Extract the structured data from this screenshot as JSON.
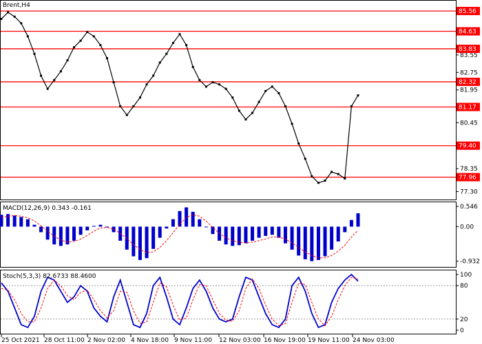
{
  "chart_data": {
    "type": "candlestick",
    "symbol_label": "Brent,H4",
    "price_axis_ticks": [
      "85.56",
      "84.63",
      "83.83",
      "83.55",
      "82.75",
      "82.32",
      "81.95",
      "81.17",
      "80.45",
      "79.40",
      "78.35",
      "77.96",
      "77.30"
    ],
    "time_axis_ticks": [
      "25 Oct 2021",
      "28 Oct 11:00",
      "2 Nov 02:00",
      "4 Nov 18:00",
      "9 Nov 11:00",
      "12 Nov 03:00",
      "16 Nov 19:00",
      "19 Nov 11:00",
      "24 Nov 03:00"
    ],
    "ylim": [
      77.0,
      86.0
    ],
    "horizontal_levels": [
      {
        "label": "85.56",
        "value": 85.56
      },
      {
        "label": "84.63",
        "value": 84.63
      },
      {
        "label": "83.83",
        "value": 83.83
      },
      {
        "label": "82.32",
        "value": 82.32
      },
      {
        "label": "81.17",
        "value": 81.17
      },
      {
        "label": "79.40",
        "value": 79.4
      },
      {
        "label": "77.96",
        "value": 77.96
      }
    ],
    "level_color": "#ff0000",
    "series": [
      {
        "name": "close",
        "color": "#000000",
        "values": [
          85.2,
          85.5,
          85.3,
          85.0,
          84.4,
          83.6,
          82.6,
          82.0,
          82.4,
          82.8,
          83.3,
          83.9,
          84.2,
          84.6,
          84.4,
          84.0,
          83.4,
          82.3,
          81.2,
          80.8,
          81.2,
          81.6,
          82.2,
          82.6,
          83.2,
          83.6,
          84.1,
          84.5,
          84.0,
          83.0,
          82.4,
          82.1,
          82.3,
          82.2,
          82.0,
          81.6,
          81.0,
          80.6,
          80.9,
          81.4,
          81.9,
          82.1,
          81.8,
          81.2,
          80.4,
          79.5,
          78.8,
          78.0,
          77.7,
          77.8,
          78.2,
          78.1,
          77.9,
          81.2,
          81.7
        ]
      }
    ],
    "indicators": [
      {
        "label": "MACD(12,26,9) 0.343 -0.161",
        "axis_ticks": [
          "0.546",
          "0.00",
          "-0.932"
        ],
        "ylim": [
          -1.05,
          0.62
        ],
        "histogram_color": "#0000cc",
        "signal_color": "#ff0000",
        "histogram": [
          0.32,
          0.34,
          0.3,
          0.26,
          0.2,
          0.05,
          -0.15,
          -0.35,
          -0.48,
          -0.52,
          -0.48,
          -0.38,
          -0.22,
          -0.1,
          0.02,
          0.05,
          0.0,
          -0.15,
          -0.38,
          -0.62,
          -0.8,
          -0.9,
          -0.85,
          -0.6,
          -0.3,
          -0.05,
          0.2,
          0.42,
          0.52,
          0.4,
          0.2,
          0.0,
          -0.2,
          -0.38,
          -0.48,
          -0.52,
          -0.5,
          -0.45,
          -0.38,
          -0.3,
          -0.25,
          -0.22,
          -0.3,
          -0.45,
          -0.62,
          -0.78,
          -0.88,
          -0.93,
          -0.9,
          -0.8,
          -0.62,
          -0.4,
          -0.15,
          0.18,
          0.36
        ],
        "signal": [
          0.25,
          0.28,
          0.3,
          0.28,
          0.24,
          0.15,
          0.02,
          -0.12,
          -0.26,
          -0.36,
          -0.42,
          -0.4,
          -0.34,
          -0.24,
          -0.12,
          -0.04,
          -0.02,
          -0.07,
          -0.18,
          -0.32,
          -0.48,
          -0.62,
          -0.7,
          -0.68,
          -0.56,
          -0.38,
          -0.16,
          0.06,
          0.25,
          0.32,
          0.28,
          0.15,
          -0.02,
          -0.18,
          -0.3,
          -0.38,
          -0.42,
          -0.44,
          -0.42,
          -0.38,
          -0.33,
          -0.28,
          -0.28,
          -0.34,
          -0.44,
          -0.56,
          -0.68,
          -0.78,
          -0.84,
          -0.84,
          -0.78,
          -0.66,
          -0.5,
          -0.28,
          -0.1
        ]
      },
      {
        "label": "Stoch(5,3,3) 82.6733 88.4600",
        "axis_ticks": [
          "100",
          "80",
          "20",
          "0"
        ],
        "ylim": [
          -5,
          105
        ],
        "levels": [
          80,
          20
        ],
        "main_color": "#0000cc",
        "signal_color": "#ff0000",
        "main": [
          85,
          70,
          40,
          10,
          5,
          25,
          70,
          95,
          90,
          70,
          50,
          60,
          80,
          70,
          40,
          25,
          15,
          60,
          90,
          50,
          10,
          5,
          30,
          80,
          95,
          60,
          20,
          10,
          40,
          75,
          90,
          70,
          40,
          20,
          15,
          20,
          60,
          95,
          90,
          60,
          30,
          10,
          5,
          20,
          80,
          95,
          70,
          30,
          5,
          10,
          50,
          75,
          90,
          100,
          88
        ],
        "signal": [
          75,
          72,
          55,
          30,
          15,
          15,
          40,
          75,
          90,
          80,
          62,
          55,
          68,
          72,
          55,
          35,
          22,
          35,
          70,
          68,
          35,
          12,
          15,
          50,
          85,
          78,
          45,
          18,
          22,
          55,
          82,
          80,
          55,
          30,
          18,
          16,
          35,
          75,
          92,
          75,
          45,
          20,
          8,
          12,
          50,
          85,
          82,
          50,
          20,
          8,
          25,
          55,
          80,
          95,
          92
        ]
      }
    ]
  }
}
